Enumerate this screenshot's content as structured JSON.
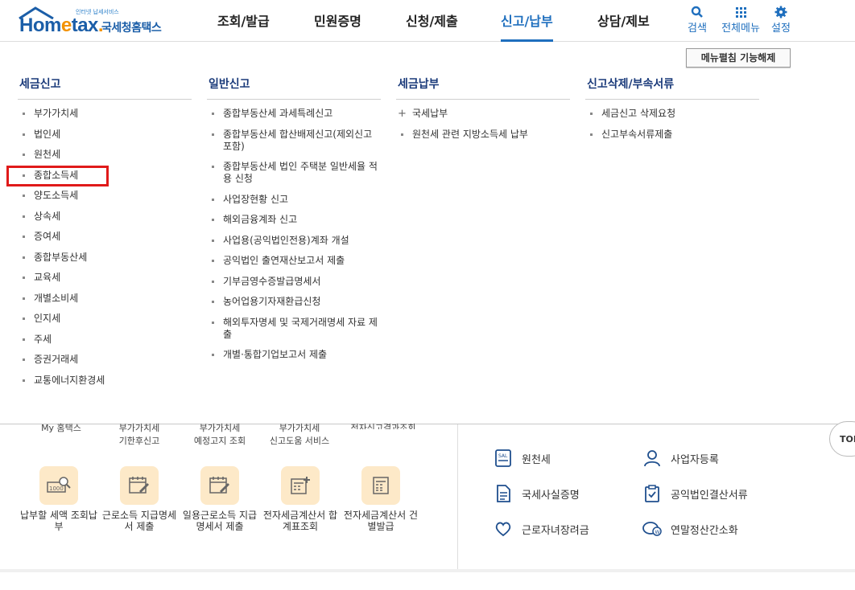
{
  "header": {
    "logo_small": "인터넷 납세서비스",
    "logo_brand_a": "Hom",
    "logo_brand_b": "e",
    "logo_brand_c": "tax",
    "logo_brand_d": ".",
    "logo_kor": "국세청홈택스",
    "nav": [
      "조회/발급",
      "민원증명",
      "신청/제출",
      "신고/납부",
      "상담/제보"
    ],
    "search_label": "검색",
    "allmenu_label": "전체메뉴",
    "settings_label": "설정"
  },
  "mega": {
    "collapse_button": "메뉴펼침 기능해제",
    "columns": [
      {
        "title": "세금신고",
        "items": [
          "부가가치세",
          "법인세",
          "원천세",
          "종합소득세",
          "양도소득세",
          "상속세",
          "증여세",
          "종합부동산세",
          "교육세",
          "개별소비세",
          "인지세",
          "주세",
          "증권거래세",
          "교통에너지환경세"
        ]
      },
      {
        "title": "일반신고",
        "items": [
          "종합부동산세 과세특례신고",
          "종합부동산세 합산배제신고(제외신고 포함)",
          "종합부동산세 법인 주택분 일반세율 적용 신청",
          "사업장현황 신고",
          "해외금융계좌 신고",
          "사업용(공익법인전용)계좌 개설",
          "공익법인 출연재산보고서 제출",
          "기부금영수증발급명세서",
          "농어업용기자재환급신청",
          "해외투자명세 및 국제거래명세 자료 제출",
          "개별·통합기업보고서 제출"
        ]
      },
      {
        "title": "세금납부",
        "items": [
          "국세납부",
          "원천세 관련 지방소득세 납부"
        ]
      },
      {
        "title": "신고삭제/부속서류",
        "items": [
          "세금신고 삭제요청",
          "신고부속서류제출"
        ]
      }
    ]
  },
  "background": {
    "partial_labels": [
      "My 홈택스",
      "부가가치세\n기한후신고",
      "부가가치세\n예정고지 조회",
      "부가가치세\n신고도움 서비스",
      "전자신고결과조회"
    ],
    "tiles": [
      {
        "label": "납부할 세액 조회납부",
        "icon": "tax-search-icon"
      },
      {
        "label": "근로소득 지급명세서 제출",
        "icon": "calendar-edit-icon"
      },
      {
        "label": "일용근로소득 지급명세서 제출",
        "icon": "calendar-edit-icon"
      },
      {
        "label": "전자세금계산서 합계표조회",
        "icon": "calculator-plus-icon"
      },
      {
        "label": "전자세금계산서 건별발급",
        "icon": "calculator-icon"
      }
    ],
    "services": [
      {
        "label": "원천세",
        "icon": "salary-document-icon"
      },
      {
        "label": "사업자등록",
        "icon": "person-icon"
      },
      {
        "label": "국세사실증명",
        "icon": "document-icon"
      },
      {
        "label": "공익법인결산서류",
        "icon": "clipboard-check-icon"
      },
      {
        "label": "근로자녀장려금",
        "icon": "heart-hands-icon"
      },
      {
        "label": "연말정산간소화",
        "icon": "won-chat-icon"
      }
    ],
    "top_button": "TOP"
  },
  "colors": {
    "brand_blue": "#1b5ea8",
    "brand_orange": "#f39200",
    "nav_active": "#1f6fbe",
    "highlight_red": "#e01a1a",
    "tile_bg": "#fde9c8"
  }
}
